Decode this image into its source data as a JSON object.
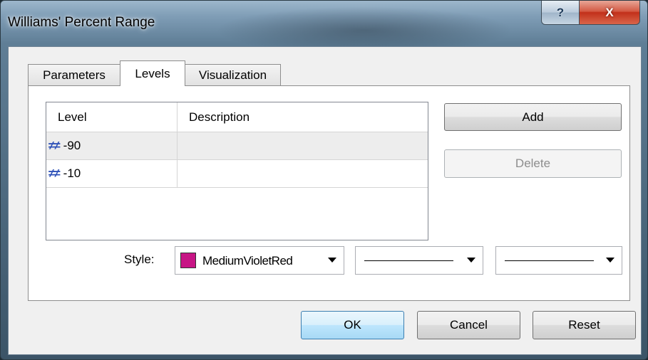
{
  "window": {
    "title": "Williams' Percent Range",
    "help_label": "?",
    "close_label": "X"
  },
  "tabs": [
    {
      "label": "Parameters",
      "active": false
    },
    {
      "label": "Levels",
      "active": true
    },
    {
      "label": "Visualization",
      "active": false
    }
  ],
  "levels_table": {
    "columns": [
      "Level",
      "Description"
    ],
    "rows": [
      {
        "icon": "level-line-icon",
        "level": "-90",
        "description": "",
        "selected": true
      },
      {
        "icon": "level-line-icon",
        "level": "-10",
        "description": "",
        "selected": false
      }
    ]
  },
  "buttons": {
    "add": "Add",
    "delete": "Delete",
    "ok": "OK",
    "cancel": "Cancel",
    "reset": "Reset"
  },
  "style": {
    "label": "Style:",
    "color_name": "MediumVioletRed",
    "color_hex": "#c71585",
    "line_style": "solid",
    "line_width": "thin"
  }
}
